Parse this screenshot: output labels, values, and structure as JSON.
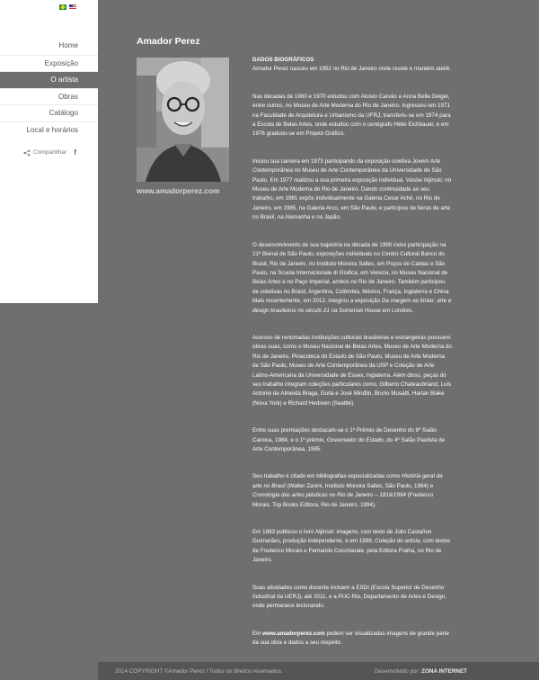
{
  "languages": [
    "pt-BR",
    "en-US"
  ],
  "nav": {
    "items": [
      "Home",
      "Exposição",
      "O artista",
      "Obras",
      "Catálogo",
      "Local e horários"
    ],
    "active_index": 2
  },
  "share": {
    "label": "Compartilhar",
    "facebook": "f"
  },
  "page": {
    "title": "Amador Perez",
    "website_caption": "www.amadorperez.com"
  },
  "bio": {
    "heading": "DADOS BIOGRÁFICOS",
    "p1": "Amador Perez nasceu em 1952 no Rio de Janeiro onde reside e mantém ateliê.",
    "p2": "Nas décadas de 1960 e 1970 estudou com Aloisio Carvão e Anna Bella Geiger, entre outros, no Museu de Arte Moderna do Rio de Janeiro. Ingressou em 1971 na Faculdade de Arquitetura e Urbanismo da UFRJ, transferiu-se em 1974 para a Escola de Belas Artes, onde estudou com o cenógrafo Hélio Eichbauer, e em 1976 graduou-se em Projeto Gráfico.",
    "p3a": "Iniciou sua carreira em 1973 participando da exposição coletiva ",
    "p3b": "Jovem Arte Contemporânea",
    "p3c": " no Museu de Arte Contemporânea da Universidade de São Paulo. Em 1977 realizou a sua primeira exposição individual, ",
    "p3d": "Vaslav Nijinski",
    "p3e": ", no Museu de Arte Moderna do Rio de Janeiro. Dando continuidade ao seu trabalho, em 1981 expôs individualmente na Galeria Cesar Aché, no Rio de Janeiro, em 1985, na Galeria Arco, em São Paulo, e participou de feiras de arte no Brasil, na Alemanha e no Japão.",
    "p4a": "O desenvolvimento de sua trajetória na década de 1990 inclui participação na 21ª Bienal de São Paulo, exposições individuais no Centro Cultural Banco do Brasil, Rio de Janeiro, no Instituto Moreira Salles, em Poços de Caldas e São Paulo, na Scuola Internazionale di Grafica, em Veneza, no Museu Nacional de Belas Artes e no Paço Imperial, ambos no Rio de Janeiro. Também participou de coletivas no Brasil, Argentina, Colômbia, México, França, Inglaterra e China. Mais recentemente, em 2012, integrou a exposição ",
    "p4b": "Da margem ao limiar: arte e design brasileiros no século 21",
    "p4c": " na Somerset House em Londres.",
    "p5": "Acervos de renomadas instituições culturais brasileiras e estrangeiras possuem obras suas, como o Museu Nacional de Belas Artes, Museu de Arte Moderna do Rio de Janeiro, Pinacoteca do Estado de São Paulo, Museu de Arte Moderna de São Paulo,  Museu de Arte Contemporânea da USP e Coleção de Arte Latino-Americana da Universidade de Essex, Inglaterra. Além disso, peças do seu trabalho integram coleções particulares como, Gilberto Chateaubriand, Luis Antonio de Almeida Braga, Guita e José Mindlin, Bruno Musatti, Harlan Blake (Nova York) e Richard Hedreen (Seattle).",
    "p6a": "Entre suas premiações destacam-se o 1º Prêmio de Desenho do 8º Salão Carioca, 1984, e o 1º prêmio, ",
    "p6b": "Governador do Estado",
    "p6c": ", do 4º Salão Paulista de Arte Contemporânea, 1985.",
    "p7a": "Seu trabalho é citado em bibliografias especializadas como ",
    "p7b": "História geral da arte no Brasil",
    "p7c": " (Walter Zanini, Instituto Moreira Salles, São Paulo, 1984) e ",
    "p7d": "Cronologia das artes plásticas no Rio de Janeiro – 1816/1994",
    "p7e": " (Frederico Morais, Top Books Editora, Rio de Janeiro, 1994).",
    "p8a": "Em 1983 publicou o livro ",
    "p8b": "Nijinski: imagens",
    "p8c": ", com texto de Júlio Castañon Guimarães, produção independente, e em 1999, ",
    "p8d": "Coleção do artista",
    "p8e": ", com textos de Frederico Morais e Fernando Cocchiarale, pela Editora Fraiha, no Rio de Janeiro.",
    "p9": "Suas atividades como docente incluem a ESDI (Escola Superior de Desenho Industrial da UERJ), até 2011, e a PUC-Rio, Departamento de Artes e Design, onde permanece lecionando.",
    "p10a": "Em ",
    "p10b": "www.amadorperez.com",
    "p10c": " podem ser visualizadas imagens de grande parte da sua obra e dados a seu respeito."
  },
  "footer": {
    "copyright": "2014 COPYRIGHT ©Amador Perez / Todos os direitos reservados.",
    "dev_label": "Desenvolvido por: ",
    "dev_name": "ZONA INTERNET"
  }
}
